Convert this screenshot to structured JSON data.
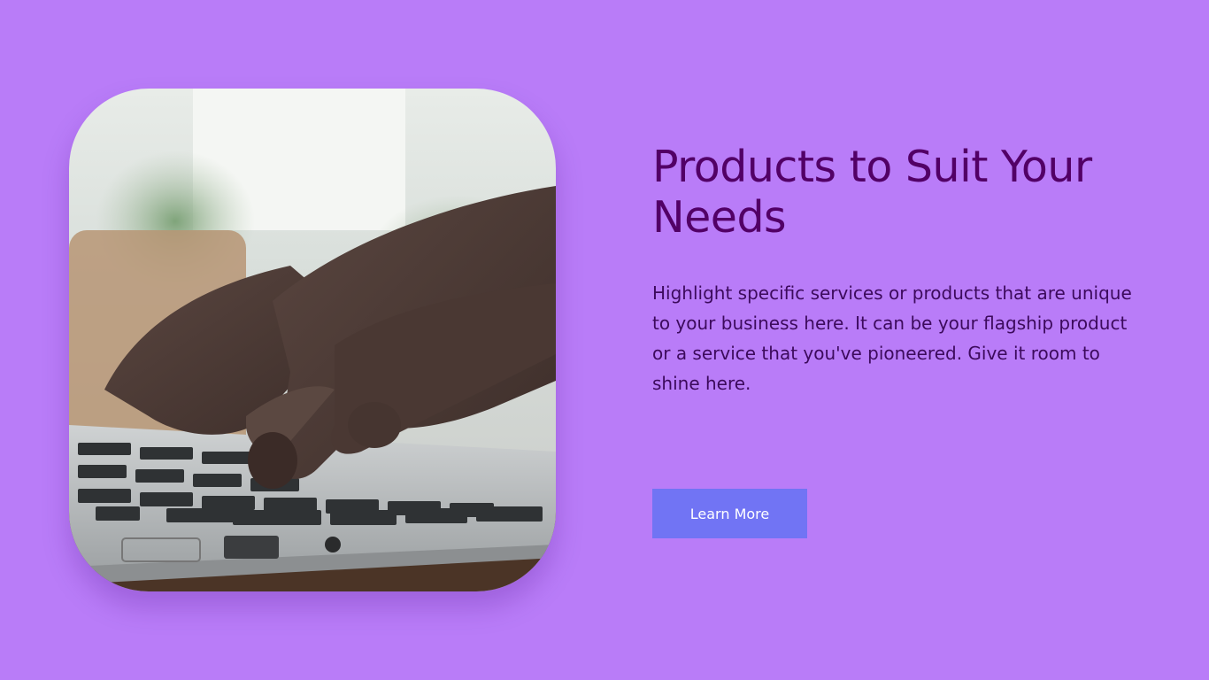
{
  "hero": {
    "image_alt": "hands typing on a laptop keyboard",
    "title": "Products to Suit Your Needs",
    "description": "Highlight specific services or products that are unique to your business here. It can be your flagship product or a service that you've pioneered. Give it room to shine here.",
    "cta_label": "Learn More"
  },
  "colors": {
    "background": "#b97cf8",
    "title": "#520066",
    "body_text": "#3c0a5c",
    "button": "#7174f4",
    "button_text": "#ffffff"
  }
}
